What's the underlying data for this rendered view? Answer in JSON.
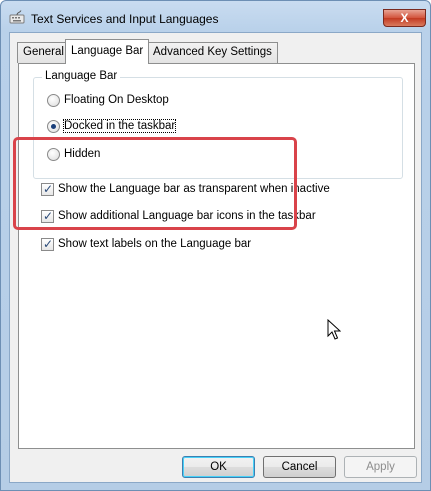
{
  "window": {
    "title": "Text Services and Input Languages",
    "close_symbol": "X"
  },
  "tabs": [
    {
      "label": "General",
      "active": false
    },
    {
      "label": "Language Bar",
      "active": true
    },
    {
      "label": "Advanced Key Settings",
      "active": false
    }
  ],
  "language_bar_group": {
    "legend": "Language Bar",
    "options": [
      {
        "label": "Floating On Desktop",
        "checked": false
      },
      {
        "label": "Docked in the taskbar",
        "checked": true
      },
      {
        "label": "Hidden",
        "checked": false
      }
    ]
  },
  "checkboxes": [
    {
      "label": "Show the Language bar as transparent when inactive",
      "checked": true
    },
    {
      "label": "Show additional Language bar icons in the taskbar",
      "checked": true
    },
    {
      "label": "Show text labels on the Language bar",
      "checked": true
    }
  ],
  "buttons": {
    "ok": "OK",
    "cancel": "Cancel",
    "apply": "Apply"
  },
  "colors": {
    "highlight": "#d9434a",
    "title_gradient": "#b9d1ea"
  },
  "icons": [
    "keyboard-app-icon",
    "close-icon",
    "mouse-cursor-icon"
  ]
}
